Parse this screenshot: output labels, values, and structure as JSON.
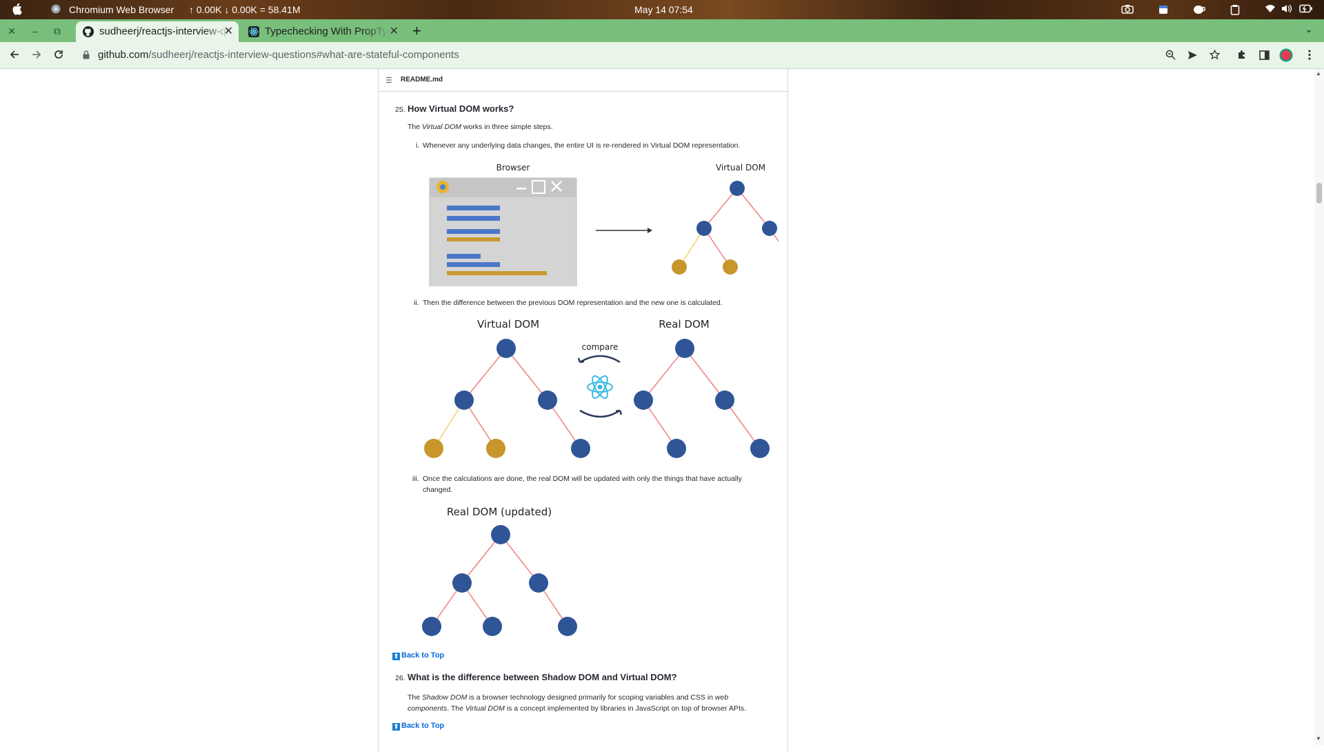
{
  "os_bar": {
    "app_name": "Chromium Web Browser",
    "net_stats": "↑ 0.00K ↓ 0.00K = 58.41M",
    "datetime": "May 14  07:54"
  },
  "tabs": [
    {
      "title": "sudheerj/reactjs-interview-questions",
      "icon": "github-icon",
      "active": true
    },
    {
      "title": "Typechecking With PropTypes",
      "icon": "react-icon",
      "active": false
    }
  ],
  "address_bar": {
    "domain": "github.com",
    "path": "/sudheerj/reactjs-interview-questions#what-are-stateful-components"
  },
  "readme": {
    "file_name": "README.md",
    "q25": {
      "number": "25.",
      "title": "How Virtual DOM works?",
      "intro_pre": "The ",
      "intro_em": "Virtual DOM",
      "intro_post": " works in three simple steps.",
      "step1_num": "i.",
      "step1": "Whenever any underlying data changes, the entire UI is re-rendered in Virtual DOM representation.",
      "step2_num": "ii.",
      "step2": "Then the difference between the previous DOM representation and the new one is calculated.",
      "step3_num": "iii.",
      "step3_line1": "Once the calculations are done, the real DOM will be updated with only the things that have actually",
      "step3_line2": "changed.",
      "diagram1": {
        "browser_label": "Browser",
        "vdom_label": "Virtual DOM"
      },
      "diagram2": {
        "vdom_label": "Virtual DOM",
        "real_label": "Real DOM",
        "compare_label": "compare"
      },
      "diagram3": {
        "label": "Real DOM (updated)"
      }
    },
    "back_to_top": "Back to Top",
    "q26": {
      "number": "26.",
      "title": "What is the difference between Shadow DOM and Virtual DOM?",
      "l1_a": "The ",
      "l1_em1": "Shadow DOM",
      "l1_b": " is a browser technology designed primarily for scoping variables and CSS in ",
      "l1_em2": "web",
      "l2_em1": "components",
      "l2_a": ". The ",
      "l2_em2": "Virtual DOM",
      "l2_b": " is a concept implemented by libraries in JavaScript on top of browser APIs."
    }
  },
  "colors": {
    "node_blue": "#2f5597",
    "node_gold": "#c8962a",
    "edge_red": "#f08080",
    "edge_yellow": "#f4d06f",
    "tab_strip": "#78bf7c",
    "link_blue": "#0969da"
  }
}
